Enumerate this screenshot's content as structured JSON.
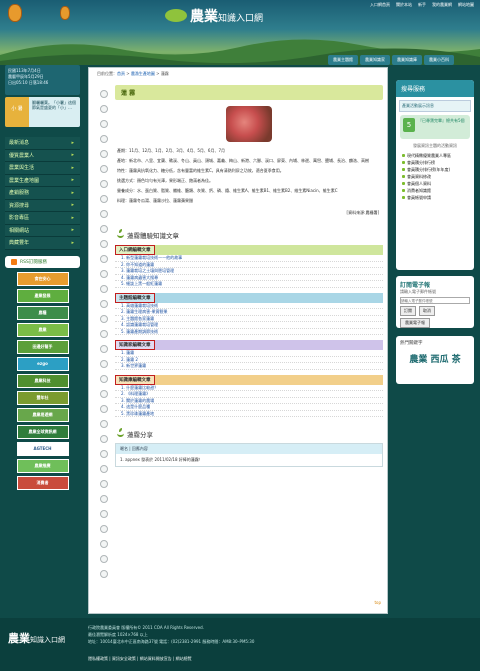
{
  "header": {
    "logo_main": "農業",
    "logo_sub": "知識入口網",
    "top_links": [
      "入口網首頁",
      "關於本站",
      "新手",
      "我的農業網",
      "網站地圖"
    ],
    "main_nav": [
      "農業主題館",
      "農業知識家",
      "農業知識庫",
      "農業小百科"
    ]
  },
  "left": {
    "date_line1": "民國113年7月4日",
    "date_line2": "農曆甲辰年5月29日",
    "date_line3": "日出05:10 日落18:46",
    "quote_label": "小 暑",
    "quote_text": "翻曬曬葉。「小暑」這個節氣是盛夏的「小」…",
    "menu": [
      "最新消息",
      "優質農業人",
      "農業與生活",
      "農業生產地圖",
      "產銷服務",
      "資源搜尋",
      "影音專區",
      "相關網站",
      "典藏豐年"
    ],
    "rss_label": "RSS訂閱服務",
    "banners": [
      "食在安心",
      "產業發展",
      "農糧",
      "農業",
      "田邊好幫手",
      "ezgo",
      "農業科技",
      "豐年社",
      "農業易遊網",
      "農業全球資訊網",
      "AGTECH",
      "農業推廣",
      "消費者"
    ]
  },
  "breadcrumb": {
    "prefix": "目前位置：",
    "home": "首頁",
    "level1": "農漁生產地圖",
    "current": "蓮霧"
  },
  "article": {
    "title": "蓮 霧",
    "paragraphs": [
      "產期：11月、12月、1月、2月、3月、4月、5月、6月、7月",
      "產地：新北市、八里、宜蘭、礁溪、冬山、員山、頭城、嘉義、梅山、新港、六腳、溪口、屏東、內埔、林邊、萬巒、鹽埔、長治、麟洛、高樹",
      "特性：蓮霧具抗氧化力、糖分低，含有豐富的維生素C，具有清熱利尿之功效，適合夏季食用。",
      "挑選方式：顏色均勻有光澤，果形端正、飽滿者為佳。",
      "營養成分：水、蛋白質、脂質、纖維、醣類、灰質、鈣、磷、鐵、維生素A、維生素B1、維生素B2、維生素Niacin、維生素C",
      "料理：蓮霧冬瓜湯、蓮霧沙拉、蓮霧蘋果醋"
    ],
    "source": "[資料來源:農糧署]"
  },
  "related": {
    "heading": "蓮霧體驗知識文章",
    "categories": [
      {
        "label": "入口網編輯文章",
        "color": "#cfe69c",
        "items": [
          "1. 新型蓮霧栽培技術——他的故事",
          "2. 你不知道的蓮霧",
          "3. 蓮霧栽培之土壤與肥培管理",
          "4. 蓮霧病蟲害大搜尋",
          "5. 細談上黑一般紅蓮霧"
        ]
      }
    ],
    "cat2": {
      "label": "主題館編輯文章",
      "color": "#a9d6e6",
      "items": [
        "1. 高雄蓮霧栽培技術",
        "2. 蓮霧生理病害-果實裂果",
        "3. 主題館各家蓮霧",
        "4. 認識蓮霧栽培管理",
        "5. 蓮霧產期調節技術"
      ]
    },
    "cat3": {
      "label": "知識家編輯文章",
      "color": "#cfc3ea",
      "items": [
        "1. 蓮霧",
        "2. 蓮霧 2",
        "3. 新世界蓮霧"
      ]
    },
    "cat4": {
      "label": "知識庫編輯文章",
      "color": "#f2cf8a",
      "items": [
        "1. 什麼蓮霧比較甜？",
        "2. 《料理蓮霧》",
        "3. 關於蓮霧的農場",
        "4. 這是什麼品種",
        "5. 黑珍珠蓮霧產地"
      ]
    }
  },
  "share": {
    "heading": "蓮霧分享",
    "col1": "暱名",
    "col2": "回應內容",
    "row": "1.  appnex 發表於 2011/02/18 好棒的蓮霧！",
    "top": "top"
  },
  "right": {
    "search_title": "搜尋服務",
    "search_tab": "產業活動展示訊息",
    "pill_num": "5",
    "pill_text": "『已尋寶完畢』總共有5個",
    "desc": "發展資訊主題的活動資訊",
    "list": [
      "現代精緻優質農業人專區",
      "會員積分排行榜",
      "會員積分排行榜(年年度)",
      "會員資料修改",
      "會員個人資料",
      "消費者知識館",
      "會員帳號申請"
    ],
    "epaper_title": "訂閱電子報",
    "epaper_sub": "請輸入電子郵件帳號",
    "epaper_placeholder": "請輸入電子郵件帳號",
    "btn_subscribe": "訂閱",
    "btn_unsubscribe": "取消",
    "btn_apply": "農業電子報",
    "hot_label": "熱門關鍵字",
    "hot_word": "農業 西瓜 茶"
  },
  "footer": {
    "logo_main": "農業",
    "logo_sub": "知識入口網",
    "line1": "行政院農業委員會 版權所有© 2011 COA All Rights Reserved.",
    "line2": "最佳瀏覽解析度 1024×768 以上",
    "line3": "地址：10014臺北市中正區南海路37號 電話：(02)2381-2991 服務時間：AM8:30–PM5:30",
    "links": "隱私權政策 | 資訊安全政策 | 網站資料開放宣告 | 網站總覽"
  },
  "colors": {
    "brand_green": "#6aa12a",
    "accent_blue": "#2b91a1",
    "dark_teal": "#0f4a48",
    "highlight_red": "#c11e1e"
  }
}
